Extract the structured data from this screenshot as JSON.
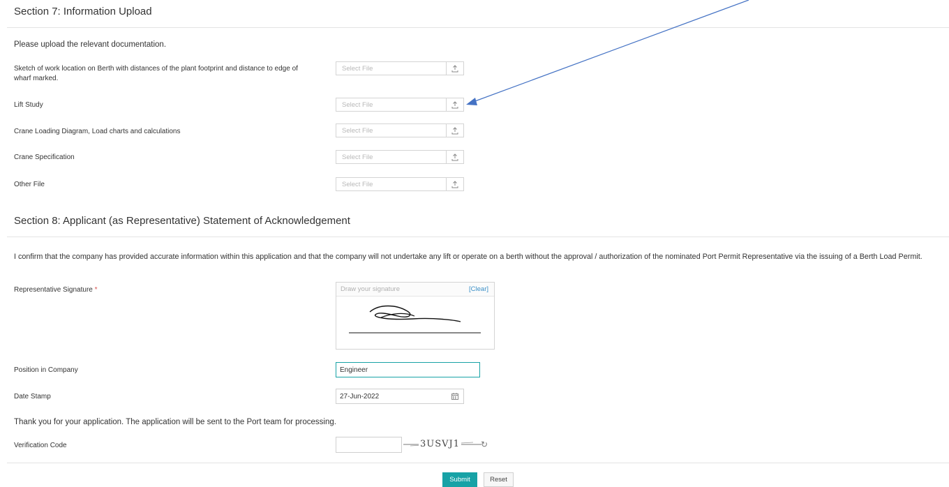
{
  "section7": {
    "title": "Section 7: Information Upload",
    "intro": "Please upload the relevant documentation.",
    "fields": [
      {
        "label": "Sketch of work location on Berth with distances of the plant footprint and distance to edge of wharf marked.",
        "placeholder": "Select File"
      },
      {
        "label": "Lift Study",
        "placeholder": "Select File"
      },
      {
        "label": "Crane Loading Diagram, Load charts and calculations",
        "placeholder": "Select File"
      },
      {
        "label": "Crane Specification",
        "placeholder": "Select File"
      },
      {
        "label": "Other File",
        "placeholder": "Select File"
      }
    ]
  },
  "section8": {
    "title": "Section 8: Applicant (as Representative) Statement of Acknowledgement",
    "statement": "I confirm that the company has provided accurate information within this application and that the company will not undertake any lift or operate on a berth without the approval / authorization of the nominated Port Permit Representative via the issuing of a Berth Load Permit.",
    "signature": {
      "label": "Representative Signature",
      "required_mark": "*",
      "placeholder": "Draw your signature",
      "clear_label": "[Clear]"
    },
    "position": {
      "label": "Position in Company",
      "value": "Engineer"
    },
    "date": {
      "label": "Date Stamp",
      "value": "27-Jun-2022"
    },
    "thank_you": "Thank you for your application. The application will be sent to the Port team for processing.",
    "verification": {
      "label": "Verification Code",
      "value": "",
      "captcha_text": "3USVJ1"
    }
  },
  "actions": {
    "submit": "Submit",
    "reset": "Reset"
  },
  "colors": {
    "accent": "#17a2a6",
    "annotation_arrow": "#4472c4",
    "required": "#d9534f"
  },
  "icons": {
    "upload": "upload-icon",
    "calendar": "calendar-icon",
    "refresh": "refresh-icon"
  }
}
